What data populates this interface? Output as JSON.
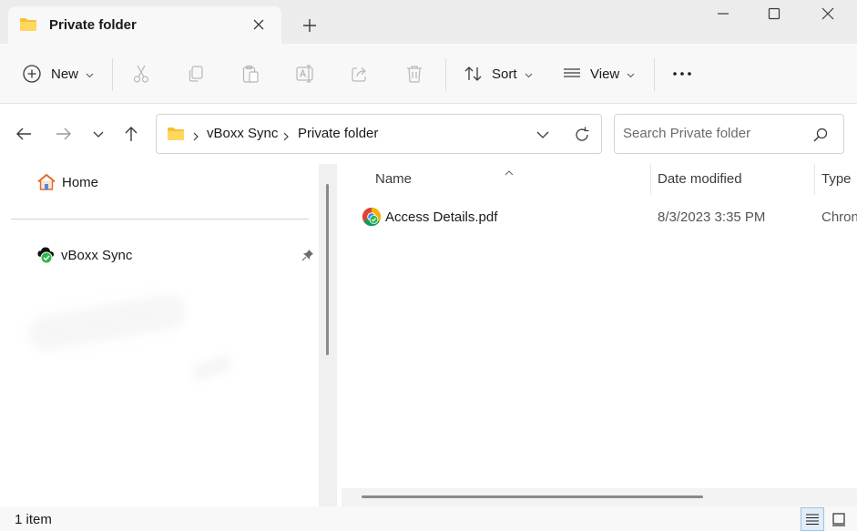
{
  "window": {
    "tab_title": "Private folder",
    "icons": {
      "tab": "folder-icon",
      "close_tab": "close-icon",
      "new_tab": "plus-icon",
      "minimize": "minimize-icon",
      "maximize": "maximize-icon",
      "close_window": "close-icon"
    }
  },
  "toolbar": {
    "new_label": "New",
    "sort_label": "Sort",
    "view_label": "View",
    "icons": [
      "add-circle-icon",
      "cut-icon",
      "copy-icon",
      "paste-icon",
      "rename-icon",
      "share-icon",
      "delete-icon",
      "sort-icon",
      "view-list-icon",
      "more-icon"
    ]
  },
  "navigation": {
    "icons": [
      "back-arrow-icon",
      "forward-arrow-icon",
      "recent-chevron-icon",
      "up-arrow-icon"
    ]
  },
  "address": {
    "crumbs": [
      "vBoxx Sync",
      "Private folder"
    ],
    "icons": [
      "folder-icon",
      "breadcrumb-chevron-icon",
      "dropdown-chevron-icon",
      "refresh-icon"
    ]
  },
  "search": {
    "placeholder": "Search Private folder",
    "value": "",
    "icon": "search-icon"
  },
  "sidebar": {
    "items": [
      {
        "label": "Home",
        "icon": "home-icon"
      },
      {
        "label": "vBoxx Sync",
        "icon": "cloud-sync-icon",
        "pinned_icon": "pin-icon"
      }
    ]
  },
  "file_list": {
    "columns": [
      "Name",
      "Date modified",
      "Type"
    ],
    "sort_indicator_icon": "sort-ascending-icon",
    "rows": [
      {
        "name": "Access Details.pdf",
        "date_modified": "8/3/2023 3:35 PM",
        "type": "Chron",
        "icon": "chrome-pdf-icon"
      }
    ]
  },
  "status": {
    "item_count": "1 item",
    "view_icons": [
      "details-view-icon",
      "tiles-view-icon"
    ]
  },
  "colors": {
    "folder_yellow": "#f4c136",
    "chrome_red": "#db4437",
    "chrome_green": "#0f9d58",
    "chrome_yellow": "#f4b400",
    "chrome_blue": "#4285f4",
    "sync_check_green": "#2db84d"
  }
}
